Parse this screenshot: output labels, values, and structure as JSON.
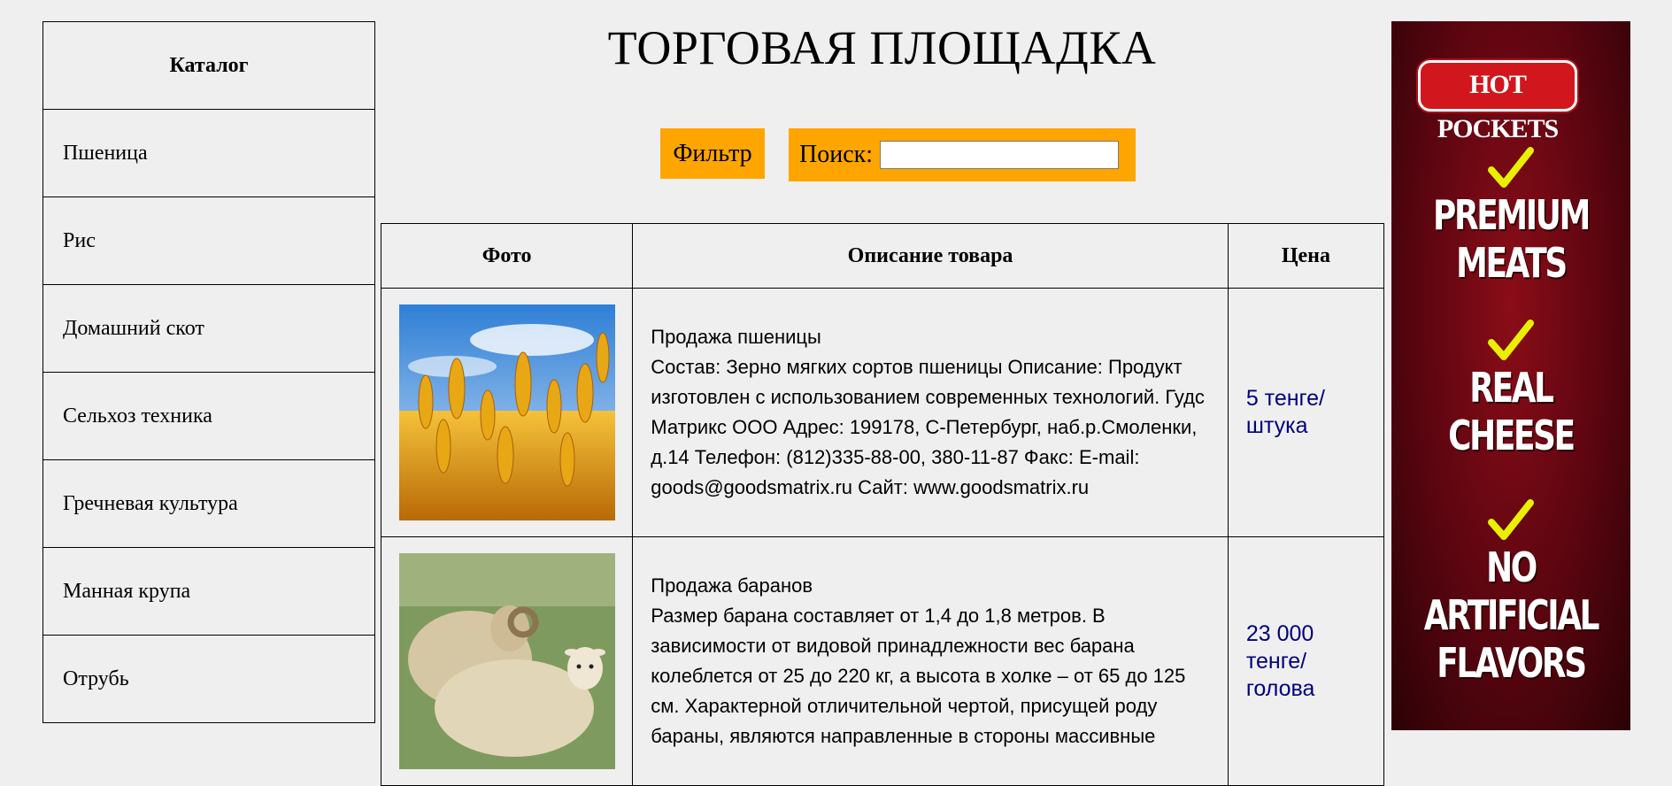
{
  "catalog": {
    "header": "Каталог",
    "items": [
      "Пшеница",
      "Рис",
      "Домашний скот",
      "Сельхоз техника",
      "Гречневая культура",
      "Манная крупа",
      "Отрубь"
    ]
  },
  "page": {
    "title": "ТОРГОВАЯ ПЛОЩАДКА"
  },
  "controls": {
    "filter_label": "Фильтр",
    "search_label": "Поиск:",
    "search_value": ""
  },
  "table": {
    "headers": {
      "photo": "Фото",
      "description": "Описание товара",
      "price": "Цена"
    },
    "rows": [
      {
        "photo_icon": "wheat-photo",
        "description": "Продажа пшеницы\nСостав: Зерно мягких сортов пшеницы Описание: Продукт изготовлен с использованием современных технологий. Гудс Матрикс ООО Адрес: 199178, С-Петербург, наб.р.Смоленки, д.14 Телефон: (812)335-88-00, 380-11-87 Факс: E-mail: goods@goodsmatrix.ru Сайт: www.goodsmatrix.ru",
        "price": "5 тенге/ штука"
      },
      {
        "photo_icon": "sheep-photo",
        "description": "Продажа баранов\nРазмер барана составляет от 1,4 до 1,8 метров. В зависимости от видовой принадлежности вес барана колеблется от 25 до 220 кг, а высота в холке – от 65 до 125 см. Характерной отличительной чертой, присущей роду бараны, являются направленные в стороны массивные",
        "price": "23 000 тенге/ голова"
      }
    ]
  },
  "ad": {
    "logo": "HOT POCKETS",
    "lines": [
      [
        "PREMIUM",
        "MEATS"
      ],
      [
        "REAL",
        "CHEESE"
      ],
      [
        "NO ARTIFICIAL",
        "FLAVORS"
      ]
    ],
    "accent_color": "#e8f000"
  }
}
